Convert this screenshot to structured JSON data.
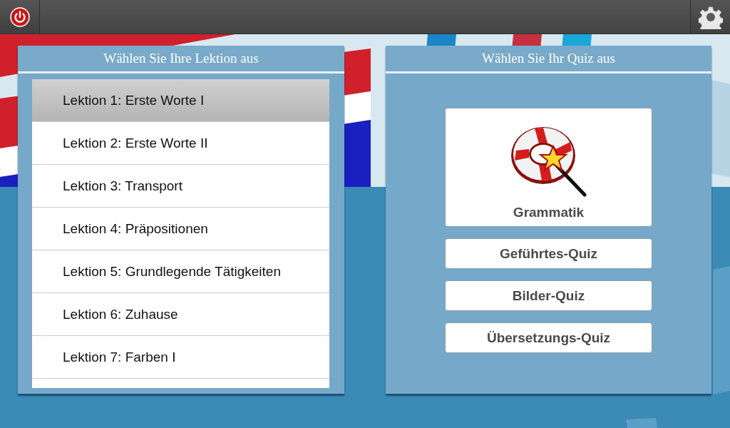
{
  "lessons_panel": {
    "title": "Wählen Sie Ihre Lektion aus",
    "lessons": [
      {
        "label": "Lektion 1: Erste Worte I",
        "selected": true
      },
      {
        "label": "Lektion 2: Erste Worte II",
        "selected": false
      },
      {
        "label": "Lektion 3: Transport",
        "selected": false
      },
      {
        "label": "Lektion 4: Präpositionen",
        "selected": false
      },
      {
        "label": "Lektion 5: Grundlegende Tätigkeiten",
        "selected": false
      },
      {
        "label": "Lektion 6: Zuhause",
        "selected": false
      },
      {
        "label": "Lektion 7: Farben I",
        "selected": false
      }
    ]
  },
  "quiz_panel": {
    "title": "Wählen Sie Ihr Quiz aus",
    "quizzes": [
      {
        "label": "Grammatik",
        "kind": "featured"
      },
      {
        "label": "Geführtes-Quiz",
        "kind": "plain"
      },
      {
        "label": "Bilder-Quiz",
        "kind": "plain"
      },
      {
        "label": "Übersetzungs-Quiz",
        "kind": "plain"
      }
    ]
  }
}
